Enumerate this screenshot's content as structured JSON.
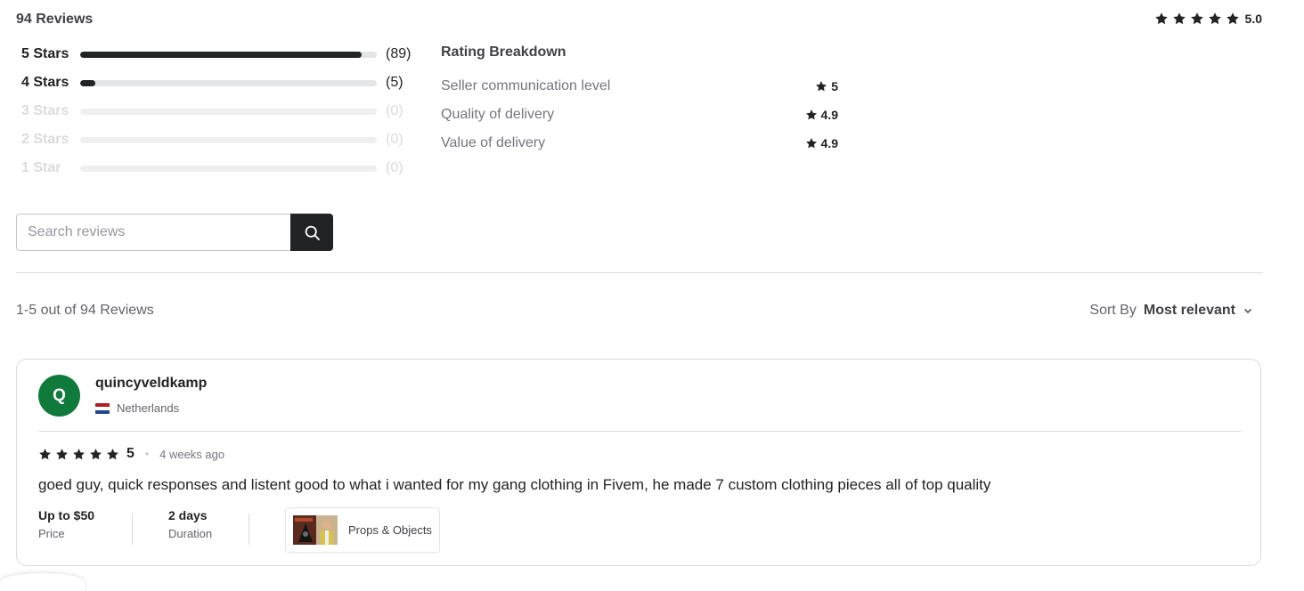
{
  "summary": {
    "reviews_count": "94 Reviews",
    "overall_rating": "5.0",
    "overall_stars": 5
  },
  "star_bars": [
    {
      "label": "5 Stars",
      "count": "(89)",
      "fraction": 0.95
    },
    {
      "label": "4 Stars",
      "count": "(5)",
      "fraction": 0.05
    },
    {
      "label": "3 Stars",
      "count": "(0)",
      "fraction": 0
    },
    {
      "label": "2 Stars",
      "count": "(0)",
      "fraction": 0
    },
    {
      "label": "1 Star",
      "count": "(0)",
      "fraction": 0
    }
  ],
  "breakdown": {
    "title": "Rating Breakdown",
    "items": [
      {
        "name": "Seller communication level",
        "score": "5"
      },
      {
        "name": "Quality of delivery",
        "score": "4.9"
      },
      {
        "name": "Value of delivery",
        "score": "4.9"
      }
    ]
  },
  "search": {
    "placeholder": "Search reviews",
    "value": ""
  },
  "list": {
    "range_text": "1-5 out of 94 Reviews",
    "sort_label": "Sort By",
    "sort_value": "Most relevant"
  },
  "review": {
    "avatar_initial": "Q",
    "avatar_color": "#0f7a3a",
    "username": "quincyveldkamp",
    "country": "Netherlands",
    "rating": "5",
    "stars": 5,
    "time": "4 weeks ago",
    "text": "goed guy, quick responses and listent good to what i wanted for my gang clothing in Fivem, he made 7 custom clothing pieces all of top quality",
    "price_value": "Up to $50",
    "price_label": "Price",
    "duration_value": "2 days",
    "duration_label": "Duration",
    "gig_label": "Props & Objects"
  },
  "icons": {
    "star": "star-icon",
    "search": "search-icon",
    "sort": "chevron-down-icon"
  },
  "colors": {
    "text_dark": "#222325",
    "accent_dark": "#222325",
    "bar_track": "#e4e5e7"
  }
}
